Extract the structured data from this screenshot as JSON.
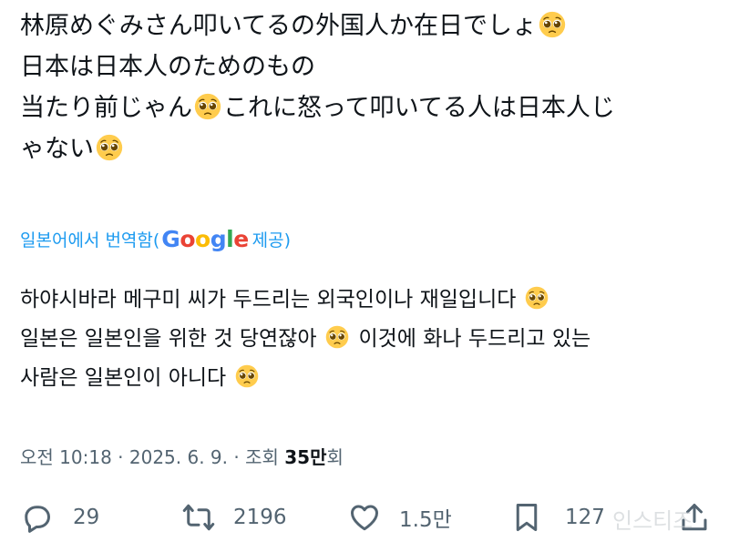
{
  "tweet": {
    "lines": [
      "林原めぐみさん叩いてるの外国人か在日でしょ",
      "日本は日本人のためのもの",
      "当たり前じゃん",
      "これに怒って叩いてる人は日本人じ",
      "ゃない"
    ],
    "emoji": "pleading-face-emoji"
  },
  "translate": {
    "prefix": "일본어에서 번역함(",
    "logo": [
      "G",
      "o",
      "o",
      "g",
      "l",
      "e"
    ],
    "suffix": " 제공)"
  },
  "translated": {
    "lines": [
      "하야시바라 메구미 씨가 두드리는 외국인이나 재일입니다",
      "일본은 일본인을 위한 것 당연잖아",
      "이것에 화나 두드리고 있는",
      "사람은 일본인이 아니다"
    ]
  },
  "meta": {
    "time": "오전 10:18 · 2025. 6. 9. · 조회 ",
    "views": "35만",
    "views_suffix": "회"
  },
  "actions": {
    "replies": "29",
    "retweets": "2196",
    "likes": "1.5만",
    "bookmarks": "127"
  },
  "watermark": "인스티즈",
  "colors": {
    "link": "#1d9bf0",
    "secondary": "#536471",
    "text": "#0f1419"
  }
}
